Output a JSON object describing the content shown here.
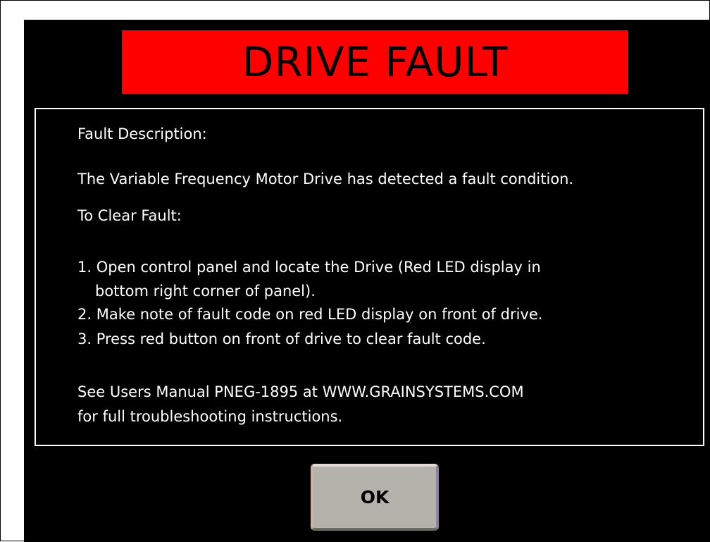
{
  "banner": {
    "title": "DRIVE FAULT",
    "color": "#ff0000"
  },
  "description": {
    "heading": "Fault Description:",
    "text": "The Variable Frequency Motor Drive has detected a fault condition.",
    "clear_heading": "To Clear Fault:",
    "steps": [
      "1. Open control panel and locate the Drive (Red LED display in",
      "bottom right corner of panel).",
      "2. Make note of fault code on red LED display on front of drive.",
      "3. Press red button on front of drive to clear fault code."
    ],
    "manual_line1": "See Users Manual PNEG-1895 at WWW.GRAINSYSTEMS.COM",
    "manual_line2": "for full troubleshooting instructions."
  },
  "button": {
    "ok_label": "OK"
  }
}
